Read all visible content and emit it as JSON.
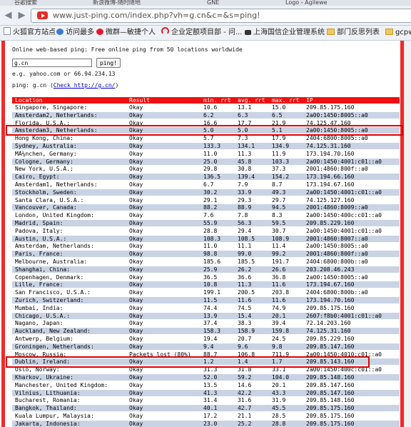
{
  "browser": {
    "tabs": [
      "谷歌搜索",
      "新浪微博-随时随地",
      "GNE",
      "Logo - Agilewe"
    ],
    "url": "www.just-ping.com/index.php?vh=g.cn&c=&s=ping!",
    "bookmarks": [
      "火狐官方站点",
      "访问最多",
      "微群—敏捷个人",
      "企业定额项目部 - 问...",
      "上海国信企业管理系统",
      "部门反思列表",
      "gcpw"
    ]
  },
  "page": {
    "intro": "Online web-based ping: Free online ping from 50 locations worldwide",
    "input_value": "g.cn",
    "button_label": "ping!",
    "example": "e.g. yahoo.com or 66.94.234.13",
    "ping_label": "ping: g.cn (",
    "check_link": "Check http://g.cn/",
    "ping_close": ")",
    "headers": [
      "Location",
      "Result",
      "min. rrt",
      "avg. rrt",
      "max. rrt",
      "IP"
    ]
  },
  "rows": [
    [
      "Singapore, Singapore:",
      "Okay",
      "10.6",
      "13.1",
      "15.0",
      "209.85.175.160"
    ],
    [
      "Amsterdam2, Netherlands:",
      "Okay",
      "6.2",
      "6.3",
      "6.5",
      "2a00:1450:8005::a0"
    ],
    [
      "Florida, U.S.A.:",
      "Okay",
      "16.6",
      "17.7",
      "21.9",
      "74.125.47.160"
    ],
    [
      "Amsterdam3, Netherlands:",
      "Okay",
      "5.0",
      "5.0",
      "5.1",
      "2a00:1450:8005::a0"
    ],
    [
      "Hong Kong, China:",
      "Okay",
      "5.7",
      "7.3",
      "17.9",
      "2404:6800:8005::a0"
    ],
    [
      "Sydney, Australia:",
      "Okay",
      "133.3",
      "134.1",
      "134.9",
      "74.125.31.160"
    ],
    [
      "MÃ¼nchen, Germany:",
      "Okay",
      "11.0",
      "11.3",
      "11.9",
      "173.194.70.160"
    ],
    [
      "Cologne, Germany:",
      "Okay",
      "25.0",
      "45.8",
      "103.3",
      "2a00:1450:4001:c01::a0"
    ],
    [
      "New York, U.S.A.:",
      "Okay",
      "29.8",
      "30.8",
      "37.3",
      "2001:4860:800f::a0"
    ],
    [
      "Cairo, Egypt:",
      "Okay",
      "136.5",
      "139.4",
      "154.2",
      "173.194.66.160"
    ],
    [
      "Amsterdam1, Netherlands:",
      "Okay",
      "6.7",
      "7.9",
      "8.7",
      "173.194.67.160"
    ],
    [
      "Stockholm, Sweden:",
      "Okay",
      "30.2",
      "33.9",
      "49.3",
      "2a00:1450:4001:c01::a0"
    ],
    [
      "Santa Clara, U.S.A.:",
      "Okay",
      "29.1",
      "29.3",
      "29.7",
      "74.125.127.160"
    ],
    [
      "Vancouver, Canada:",
      "Okay",
      "88.2",
      "88.9",
      "94.5",
      "2001:4860:8009::a0"
    ],
    [
      "London, United Kingdom:",
      "Okay",
      "7.6",
      "7.8",
      "8.3",
      "2a00:1450:400c:c01::a0"
    ],
    [
      "Madrid, Spain:",
      "Okay",
      "55.9",
      "56.3",
      "59.5",
      "209.85.229.160"
    ],
    [
      "Padova, Italy:",
      "Okay",
      "28.8",
      "29.4",
      "30.7",
      "2a00:1450:4001:c01::a0"
    ],
    [
      "Austin, U.S.A.:",
      "Okay",
      "108.3",
      "108.5",
      "108.9",
      "2001:4860:8007::a0"
    ],
    [
      "Amsterdam, Netherlands:",
      "Okay",
      "11.0",
      "11.1",
      "11.4",
      "2a00:1450:8005::a0"
    ],
    [
      "Paris, France:",
      "Okay",
      "98.8",
      "99.0",
      "99.2",
      "2001:4860:800f::a0"
    ],
    [
      "Melbourne, Australia:",
      "Okay",
      "185.6",
      "185.5",
      "191.7",
      "2404:6800:800b::a0"
    ],
    [
      "Shanghai, China:",
      "Okay",
      "25.9",
      "26.2",
      "26.6",
      "203.208.46.243"
    ],
    [
      "Copenhagen, Denmark:",
      "Okay",
      "36.5",
      "36.6",
      "36.8",
      "2a00:1450:8005::a0"
    ],
    [
      "Lille, France:",
      "Okay",
      "10.8",
      "11.3",
      "11.6",
      "173.194.67.160"
    ],
    [
      "San Francisco, U.S.A.:",
      "Okay",
      "199.1",
      "200.5",
      "203.8",
      "2404:6800:800b::a0"
    ],
    [
      "Zurich, Switzerland:",
      "Okay",
      "11.5",
      "11.6",
      "11.6",
      "173.194.70.160"
    ],
    [
      "Mumbai, India:",
      "Okay",
      "74.4",
      "74.5",
      "74.9",
      "209.85.175.160"
    ],
    [
      "Chicago, U.S.A.:",
      "Okay",
      "13.9",
      "15.4",
      "20.1",
      "2607:f8b0:4001:c01::a0"
    ],
    [
      "Nagano, Japan:",
      "Okay",
      "37.4",
      "38.3",
      "39.4",
      "72.14.203.160"
    ],
    [
      "Auckland, New Zealand:",
      "Okay",
      "158.3",
      "158.9",
      "159.8",
      "74.125.31.160"
    ],
    [
      "Antwerp, Belgium:",
      "Okay",
      "19.4",
      "20.7",
      "24.5",
      "209.85.229.160"
    ],
    [
      "Groningen, Netherlands:",
      "Okay",
      "9.4",
      "9.6",
      "9.8",
      "209.85.147.160"
    ],
    [
      "Moscow, Russia:",
      "Packets lost (80%)",
      "88.7",
      "106.8",
      "711.9",
      "2a00:1450:4010:c01::a0"
    ],
    [
      "Dublin, Ireland:",
      "Okay",
      "1.2",
      "1.4",
      "1.7",
      "209.85.143.160"
    ],
    [
      "Oslo, Norway:",
      "Okay",
      "31.3",
      "31.8",
      "33.1",
      "2a00:1450:400c:c01::a0"
    ],
    [
      "Kharkov, Ukraine:",
      "Okay",
      "52.0",
      "59.2",
      "104.0",
      "209.85.148.160"
    ],
    [
      "Manchester, United Kingdom:",
      "Okay",
      "13.5",
      "14.6",
      "20.1",
      "209.85.147.160"
    ],
    [
      "Vilnius, Lithuania:",
      "Okay",
      "41.3",
      "42.2",
      "43.3",
      "209.85.147.160"
    ],
    [
      "Bucharest, Romania:",
      "Okay",
      "31.4",
      "31.6",
      "31.9",
      "209.85.148.160"
    ],
    [
      "Bangkok, Thailand:",
      "Okay",
      "40.1",
      "42.7",
      "45.5",
      "209.85.175.160"
    ],
    [
      "Kuala Lumpur, Malaysia:",
      "Okay",
      "17.2",
      "21.1",
      "28.5",
      "209.85.175.160"
    ],
    [
      "Jakarta, Indonesia:",
      "Okay",
      "23.0",
      "25.2",
      "28.8",
      "209.85.175.160"
    ]
  ],
  "colors": {
    "header_bg": "#ee1111",
    "row_a": "#ffffff",
    "row_b": "#c9d3e4",
    "frame": "#ef2a2a",
    "highlight": "#e00000"
  }
}
